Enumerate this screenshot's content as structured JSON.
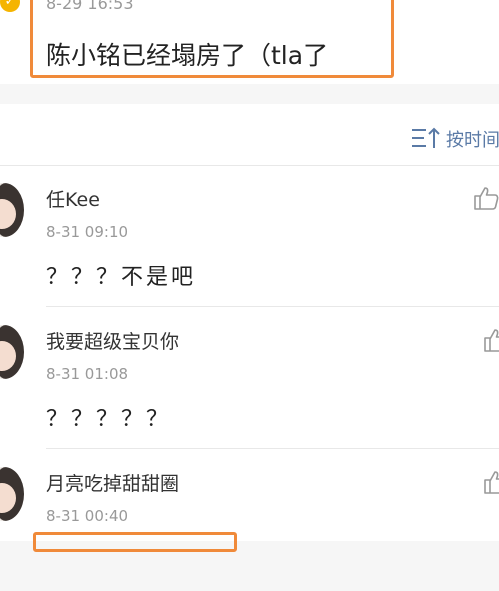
{
  "post": {
    "time": "8-29 16:53",
    "text": "陈小铭已经塌房了（tla了"
  },
  "sort": {
    "label": "按时间"
  },
  "comments": [
    {
      "user": "任Kee",
      "time": "8-31 09:10",
      "text": "？？？不是吧"
    },
    {
      "user": "我要超级宝贝你",
      "time": "8-31 01:08",
      "text": "？？？？？"
    },
    {
      "user": "月亮吃掉甜甜圈",
      "time": "8-31 00:40",
      "text": ""
    }
  ],
  "colors": {
    "highlight": "#f08a3a",
    "sort_link": "#5a7aa6"
  },
  "icons": {
    "sort": "sort-icon",
    "like": "thumbs-up-icon",
    "badge": "verified-badge-icon"
  }
}
